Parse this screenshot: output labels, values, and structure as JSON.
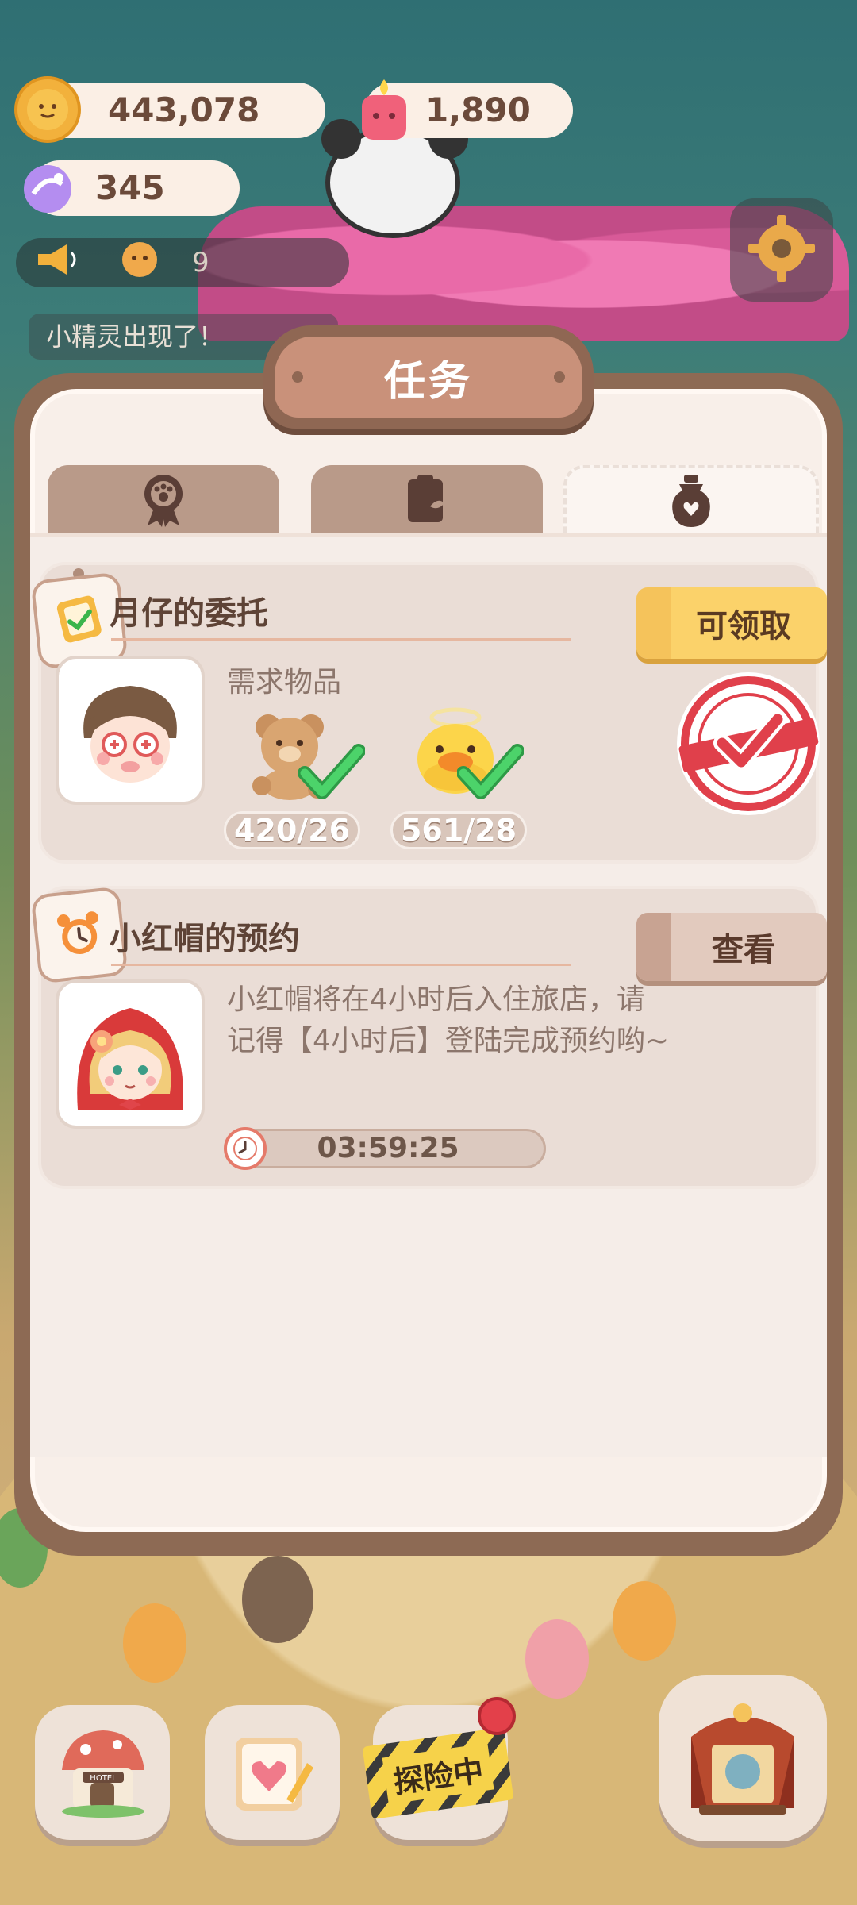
{
  "hud": {
    "coins": "443,078",
    "candles": "1,890",
    "crystals": "345",
    "visitors": "9",
    "notice": "小精灵出现了！"
  },
  "panel": {
    "title": "任务",
    "tabs": [
      {
        "icon": "medal-icon",
        "active": false
      },
      {
        "icon": "memo-icon",
        "active": false
      },
      {
        "icon": "bottle-heart-icon",
        "active": true
      }
    ]
  },
  "tasks": [
    {
      "title": "月仔的委托",
      "requirement_label": "需求物品",
      "items": [
        {
          "icon": "teddy-bear-icon",
          "progress": "420/26"
        },
        {
          "icon": "duck-icon",
          "progress": "561/28"
        }
      ],
      "button": "可领取"
    },
    {
      "title": "小红帽的预约",
      "description": "小红帽将在4小时后入住旅店，请记得【4小时后】登陆完成预约哟~",
      "timer": "03:59:25",
      "button": "查看"
    }
  ],
  "dock": {
    "explore_label": "探险中",
    "hotel_sign": "HOTEL"
  },
  "colors": {
    "panel_border": "#8d6a54",
    "claim_button": "#fbd26a",
    "check_green": "#4cd36a",
    "stamp_red": "#e0404b"
  }
}
